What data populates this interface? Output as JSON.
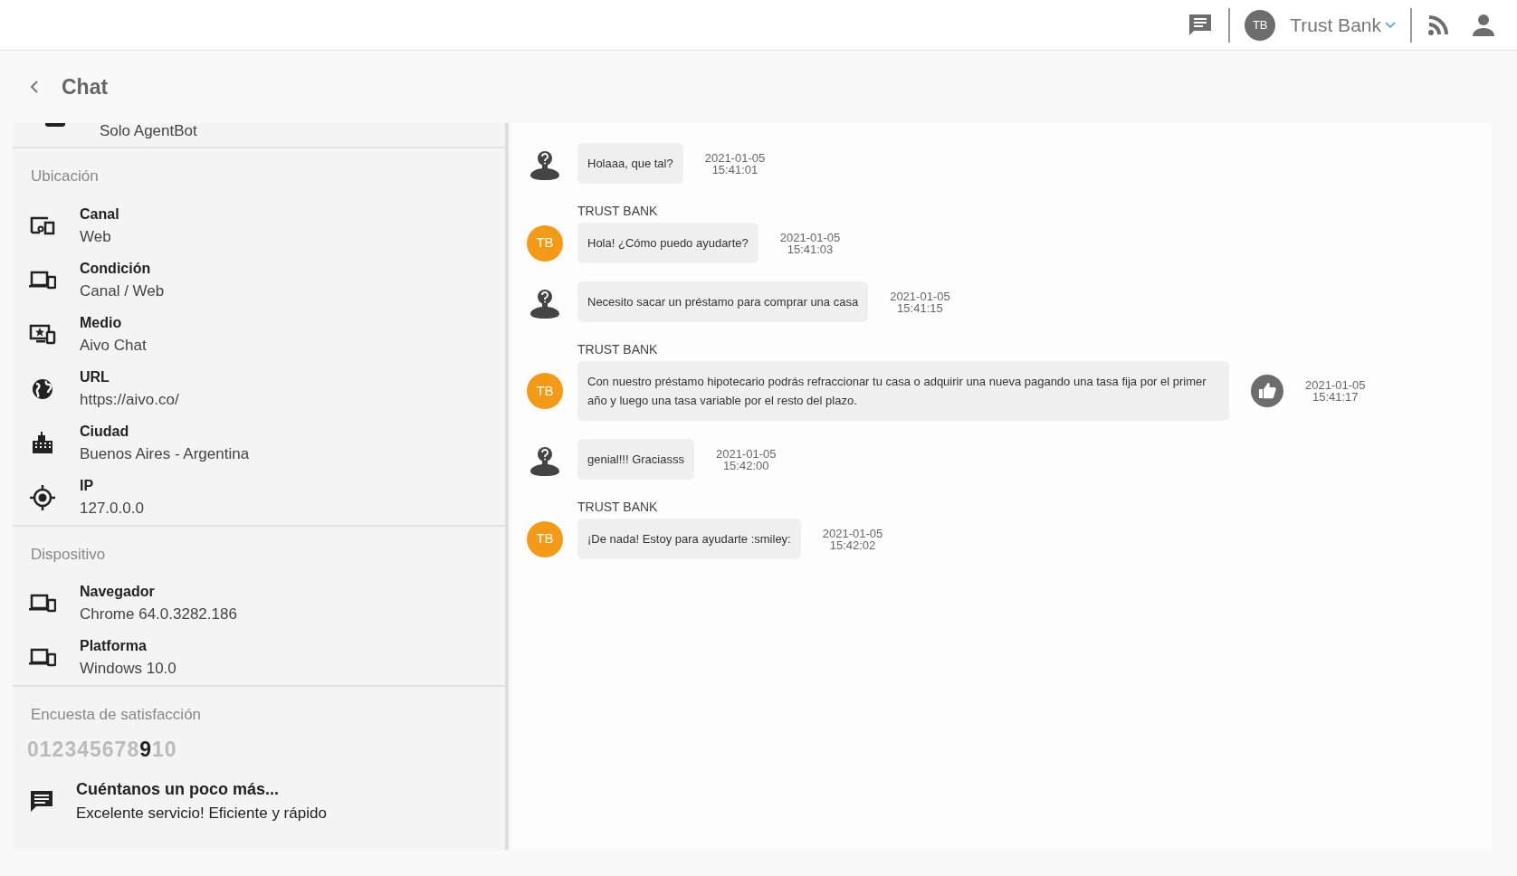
{
  "topbar": {
    "avatar": "TB",
    "account": "Trust Bank"
  },
  "header": {
    "title": "Chat"
  },
  "sidebar": {
    "partial_item": {
      "value": "Solo AgentBot"
    },
    "sections": [
      {
        "title": "Ubicación",
        "items": [
          {
            "label": "Canal",
            "value": "Web"
          },
          {
            "label": "Condición",
            "value": "Canal / Web"
          },
          {
            "label": "Medio",
            "value": "Aivo Chat"
          },
          {
            "label": "URL",
            "value": "https://aivo.co/"
          },
          {
            "label": "Ciudad",
            "value": "Buenos Aires - Argentina"
          },
          {
            "label": "IP",
            "value": "127.0.0.0"
          }
        ]
      },
      {
        "title": "Dispositivo",
        "items": [
          {
            "label": "Navegador",
            "value": "Chrome 64.0.3282.186"
          },
          {
            "label": "Platforma",
            "value": "Windows 10.0"
          }
        ]
      }
    ],
    "survey": {
      "title": "Encuesta de satisfacción",
      "scores": [
        {
          "label": "0",
          "selected": false
        },
        {
          "label": "1",
          "selected": false
        },
        {
          "label": "2",
          "selected": false
        },
        {
          "label": "3",
          "selected": false
        },
        {
          "label": "4",
          "selected": false
        },
        {
          "label": "5",
          "selected": false
        },
        {
          "label": "6",
          "selected": false
        },
        {
          "label": "7",
          "selected": false
        },
        {
          "label": "8",
          "selected": false
        },
        {
          "label": "9",
          "selected": true
        },
        {
          "label": "10",
          "selected": false
        }
      ],
      "comment_title": "Cuéntanos un poco más...",
      "comment": "Excelente servicio! Eficiente y rápido"
    }
  },
  "messages": [
    {
      "kind": "user",
      "text": "Holaaa, que tal?",
      "date": "2021-01-05",
      "time": "15:41:01",
      "liked": false
    },
    {
      "kind": "bot",
      "sender": "TRUST BANK",
      "avatar": "TB",
      "text": "Hola! ¿Cómo puedo ayudarte?",
      "date": "2021-01-05",
      "time": "15:41:03",
      "liked": false
    },
    {
      "kind": "user",
      "text": "Necesito sacar un préstamo para comprar una casa",
      "date": "2021-01-05",
      "time": "15:41:15",
      "liked": false
    },
    {
      "kind": "bot",
      "sender": "TRUST BANK",
      "avatar": "TB",
      "text": "Con nuestro préstamo hipotecario podrás refraccionar tu casa o adquirir una nueva pagando una tasa fija por el primer año y luego una tasa variable por el resto del plazo.",
      "date": "2021-01-05",
      "time": "15:41:17",
      "liked": true
    },
    {
      "kind": "user",
      "text": "genial!!! Graciasss",
      "date": "2021-01-05",
      "time": "15:42:00",
      "liked": false
    },
    {
      "kind": "bot",
      "sender": "TRUST BANK",
      "avatar": "TB",
      "text": "¡De nada! Estoy para ayudarte :smiley:",
      "date": "2021-01-05",
      "time": "15:42:02",
      "liked": false
    }
  ]
}
